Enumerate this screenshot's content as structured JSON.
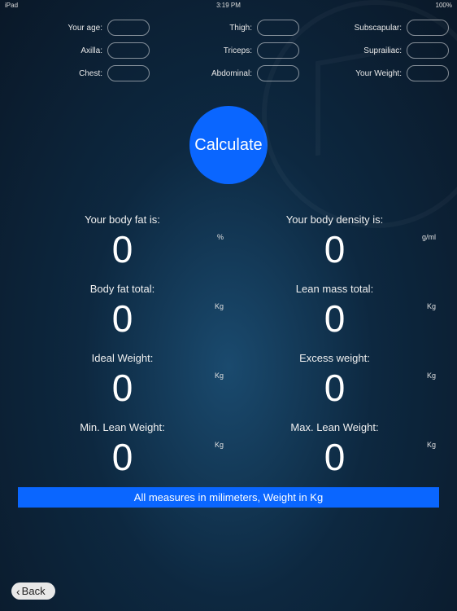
{
  "status": {
    "carrier": "iPad",
    "time": "3:19 PM",
    "battery": "100%"
  },
  "inputs": [
    {
      "label": "Your age:"
    },
    {
      "label": "Thigh:"
    },
    {
      "label": "Subscapular:"
    },
    {
      "label": "Axilla:"
    },
    {
      "label": "Triceps:"
    },
    {
      "label": "Suprailiac:"
    },
    {
      "label": "Chest:"
    },
    {
      "label": "Abdominal:"
    },
    {
      "label": "Your Weight:"
    }
  ],
  "calculate_label": "Calculate",
  "results": [
    {
      "label": "Your body fat is:",
      "value": "0",
      "unit": "%"
    },
    {
      "label": "Your body density is:",
      "value": "0",
      "unit": "g/ml"
    },
    {
      "label": "Body fat total:",
      "value": "0",
      "unit": "Kg"
    },
    {
      "label": "Lean mass total:",
      "value": "0",
      "unit": "Kg"
    },
    {
      "label": "Ideal Weight:",
      "value": "0",
      "unit": "Kg"
    },
    {
      "label": "Excess weight:",
      "value": "0",
      "unit": "Kg"
    },
    {
      "label": "Min. Lean Weight:",
      "value": "0",
      "unit": "Kg"
    },
    {
      "label": "Max. Lean Weight:",
      "value": "0",
      "unit": "Kg"
    }
  ],
  "footer_note": "All measures in milimeters, Weight in Kg",
  "back_label": "Back"
}
